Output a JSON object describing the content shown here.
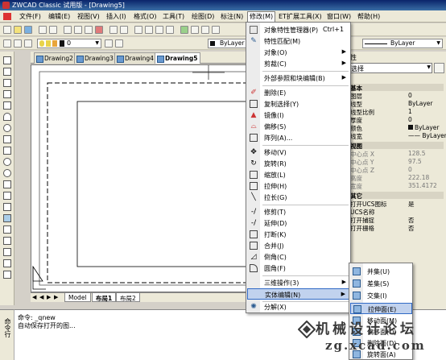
{
  "window": {
    "title": "ZWCAD Classic 试用版 - [Drawing5]"
  },
  "menubar": {
    "items": [
      {
        "label": "文件(F)"
      },
      {
        "label": "编辑(E)"
      },
      {
        "label": "视图(V)"
      },
      {
        "label": "插入(I)"
      },
      {
        "label": "格式(O)"
      },
      {
        "label": "工具(T)"
      },
      {
        "label": "绘图(D)"
      },
      {
        "label": "标注(N)"
      },
      {
        "label": "修改(M)"
      },
      {
        "label": "ET扩展工具(X)"
      },
      {
        "label": "窗口(W)"
      },
      {
        "label": "帮助(H)"
      }
    ],
    "active": "修改(M)"
  },
  "toolbar2": {
    "layer_value": "0",
    "linetype_value": "ByLayer",
    "lineweight_value": "ByLayer"
  },
  "doc_tabs": [
    {
      "label": "Drawing2"
    },
    {
      "label": "Drawing3"
    },
    {
      "label": "Drawing4"
    },
    {
      "label": "Drawing5",
      "active": true
    }
  ],
  "layout_tabs": [
    {
      "label": "Model"
    },
    {
      "label": "布局1",
      "active": true
    },
    {
      "label": "布局2"
    }
  ],
  "modify_menu": {
    "items": [
      {
        "label": "对象特性管理器(P)",
        "shortcut": "Ctrl+1",
        "icon": "properties-icon"
      },
      {
        "label": "特性匹配(M)",
        "icon": "match-brush-icon"
      },
      {
        "label": "对象(O)",
        "submenu": true
      },
      {
        "label": "剪裁(C)",
        "submenu": true
      },
      {
        "label": "外部参照和块编辑(B)",
        "submenu": true
      },
      {
        "label": "删除(E)",
        "icon": "eraser-icon"
      },
      {
        "label": "复制选择(Y)",
        "icon": "copy-icon"
      },
      {
        "label": "镜像(I)",
        "icon": "mirror-icon"
      },
      {
        "label": "偏移(S)",
        "icon": "offset-icon"
      },
      {
        "label": "阵列(A)...",
        "icon": "array-icon"
      },
      {
        "label": "移动(V)",
        "icon": "move-icon"
      },
      {
        "label": "旋转(R)",
        "icon": "rotate-icon"
      },
      {
        "label": "缩放(L)",
        "icon": "scale-icon"
      },
      {
        "label": "拉伸(H)",
        "icon": "stretch-icon"
      },
      {
        "label": "拉长(G)",
        "icon": "lengthen-icon"
      },
      {
        "label": "修剪(T)",
        "icon": "trim-icon"
      },
      {
        "label": "延伸(D)",
        "icon": "extend-icon"
      },
      {
        "label": "打断(K)",
        "icon": "break-icon"
      },
      {
        "label": "合并(J)",
        "icon": "join-icon"
      },
      {
        "label": "倒角(C)",
        "icon": "chamfer-icon"
      },
      {
        "label": "圆角(F)",
        "icon": "fillet-icon"
      },
      {
        "label": "三维操作(3)",
        "submenu": true
      },
      {
        "label": "实体编辑(N)",
        "submenu": true,
        "highlighted": true
      },
      {
        "label": "分解(X)",
        "icon": "explode-icon"
      }
    ]
  },
  "solid_edit_submenu": {
    "items": [
      {
        "label": "并集(U)"
      },
      {
        "label": "差集(S)"
      },
      {
        "label": "交集(I)"
      },
      {
        "label": "拉伸面(E)",
        "highlighted": true
      },
      {
        "label": "移动面(M)"
      },
      {
        "label": "偏移面(O)"
      },
      {
        "label": "删除面(D)"
      },
      {
        "label": "旋转面(A)"
      }
    ]
  },
  "properties": {
    "title": "性",
    "selector": "选择",
    "sections": [
      {
        "header": "基本",
        "rows": [
          {
            "k": "图层",
            "v": "0"
          },
          {
            "k": "线型",
            "v": "ByLayer"
          },
          {
            "k": "线型比例",
            "v": "1"
          },
          {
            "k": "厚度",
            "v": "0"
          },
          {
            "k": "颜色",
            "v": "ByLayer"
          },
          {
            "k": "线宽",
            "v": "—— ByLayer"
          }
        ]
      },
      {
        "header": "视图",
        "rows": [
          {
            "k": "中心点 X",
            "v": "128.5",
            "grey": true
          },
          {
            "k": "中心点 Y",
            "v": "97.5",
            "grey": true
          },
          {
            "k": "中心点 Z",
            "v": "0",
            "grey": true
          },
          {
            "k": "高度",
            "v": "222.18",
            "grey": true
          },
          {
            "k": "宽度",
            "v": "351.4172",
            "grey": true
          }
        ]
      },
      {
        "header": "其它",
        "rows": [
          {
            "k": "打开UCS图标",
            "v": "是"
          },
          {
            "k": "UCS名称",
            "v": ""
          },
          {
            "k": "打开捕捉",
            "v": "否"
          },
          {
            "k": "打开栅格",
            "v": "否"
          }
        ]
      }
    ]
  },
  "command": {
    "side_label": "命令行",
    "lines": [
      "命令: _qnew",
      "自动保存打开的图..."
    ]
  },
  "watermark": {
    "text": "机械设计论坛",
    "url": "zg.xcad.com"
  }
}
